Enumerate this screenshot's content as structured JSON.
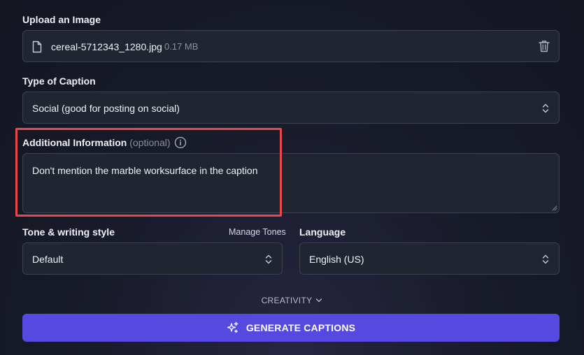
{
  "upload": {
    "label": "Upload an Image",
    "file_name": "cereal-5712343_1280.jpg",
    "file_size": "0.17 MB"
  },
  "caption_type": {
    "label": "Type of Caption",
    "selected": "Social (good for posting on social)"
  },
  "additional_info": {
    "label": "Additional Information",
    "optional": "(optional)",
    "value": "Don't mention the marble worksurface in the caption"
  },
  "tone": {
    "label": "Tone & writing style",
    "manage_link": "Manage Tones",
    "selected": "Default"
  },
  "language": {
    "label": "Language",
    "selected": "English (US)"
  },
  "creativity": {
    "label": "CREATIVITY"
  },
  "generate": {
    "label": "GENERATE CAPTIONS"
  },
  "colors": {
    "accent": "#5549e0",
    "highlight": "#e8474c",
    "field_bg": "#1f2531"
  },
  "icons": [
    "file-icon",
    "trash-icon",
    "info-icon",
    "chevron-updown-icon",
    "chevron-down-icon",
    "sparkles-icon"
  ]
}
